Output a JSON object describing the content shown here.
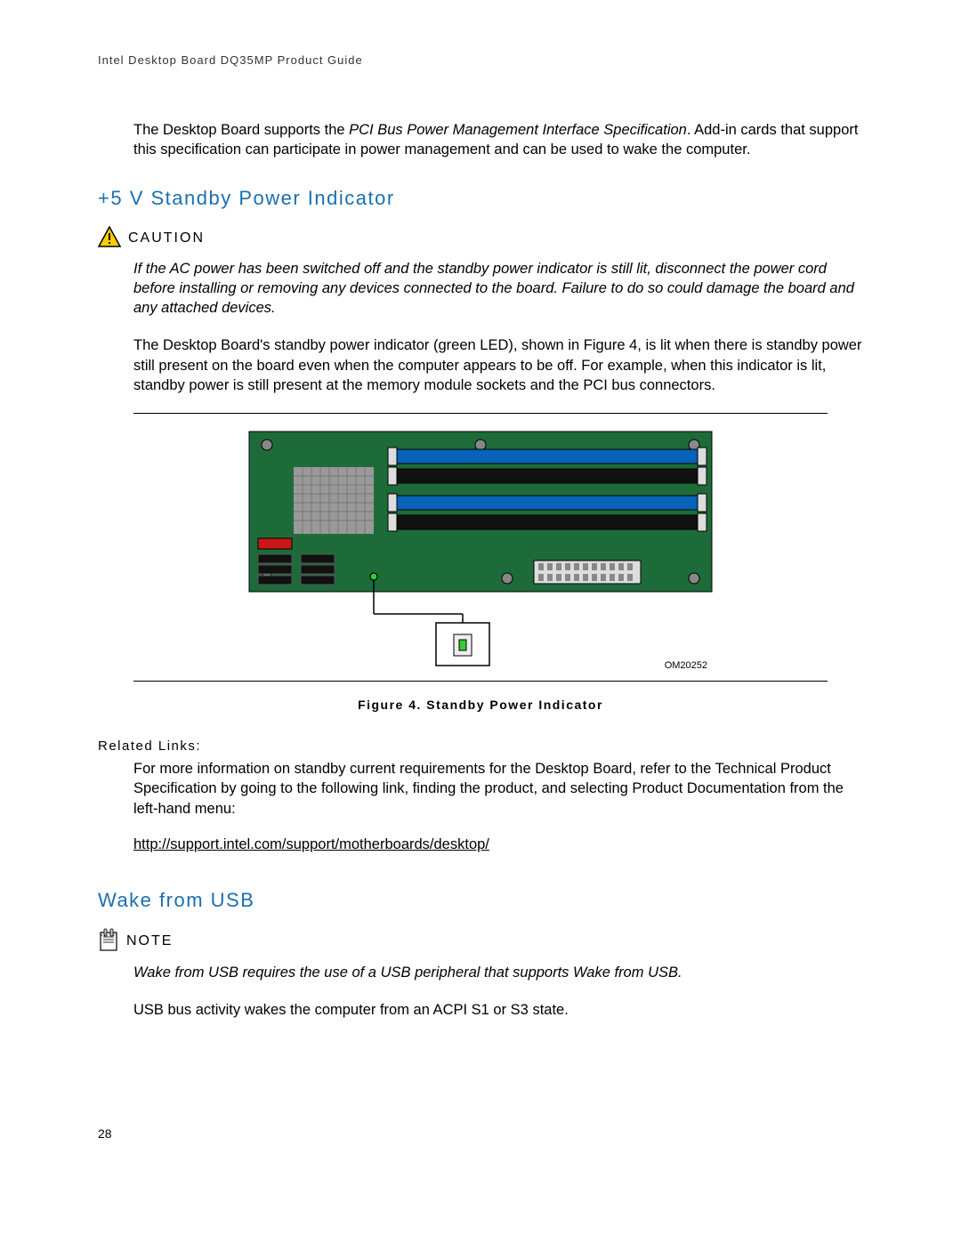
{
  "header": "Intel Desktop Board DQ35MP Product Guide",
  "intro_paragraph": {
    "part1": "The Desktop Board supports the ",
    "italic": "PCI Bus Power Management Interface Specification",
    "part2": ". Add-in cards that support this specification can participate in power management and can be used to wake the computer."
  },
  "section1": {
    "heading": "+5 V Standby Power Indicator",
    "caution_label": "CAUTION",
    "caution_text": "If the AC power has been switched off and the standby power indicator is still lit, disconnect the power cord before installing or removing any devices connected to the board.  Failure to do so could damage the board and any attached devices.",
    "body": "The Desktop Board's standby power indicator (green LED), shown in Figure 4, is lit when there is standby power still present on the board even when the computer appears to be off.  For example, when this indicator is lit, standby power is still present at the memory module sockets and the PCI bus connectors.",
    "figure_caption": "Figure 4.  Standby Power Indicator",
    "figure_id": "OM20252",
    "related_links_label": "Related Links:",
    "related_text": "For more information on standby current requirements for the Desktop Board, refer to the Technical Product Specification by going to the following link, finding the product, and selecting Product Documentation from the left-hand menu:",
    "related_url": "http://support.intel.com/support/motherboards/desktop/"
  },
  "section2": {
    "heading": "Wake from USB",
    "note_label": "NOTE",
    "note_text": "Wake from USB requires the use of a USB peripheral that supports Wake from USB.",
    "body": "USB bus activity wakes the computer from an ACPI S1 or S3 state."
  },
  "page_number": "28"
}
